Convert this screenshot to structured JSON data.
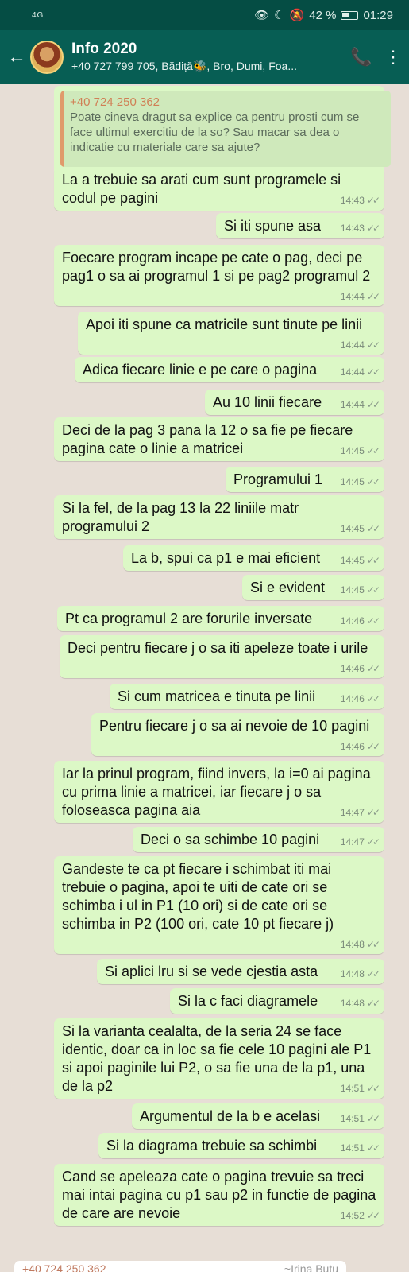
{
  "status": {
    "signal": "4G",
    "battery": "42 %",
    "time": "01:29"
  },
  "header": {
    "back_icon": "arrow-left",
    "title": "Info 2020",
    "subtitle": "+40 727 799 705, Bădiță🐝, Bro, Dumi, Foa...",
    "call_icon": "add-call",
    "menu_icon": "more-vertical"
  },
  "quote": {
    "author": "+40 724 250 362",
    "text": "Poate cineva dragut sa explice ca pentru prosti cum se face ultimul exercitiu de la so? Sau macar sa dea o indicatie cu materiale care sa ajute?"
  },
  "messages": [
    {
      "text": "La a trebuie sa arati cum sunt programele si codul pe pagini",
      "time": "14:43"
    },
    {
      "text": "Si iti spune asa",
      "time": "14:43"
    },
    {
      "text": "Foecare program incape pe cate o pag, deci pe pag1 o sa ai programul 1 si pe pag2 programul 2",
      "time": "14:44"
    },
    {
      "text": "Apoi iti spune ca matricile sunt tinute pe linii",
      "time": "14:44"
    },
    {
      "text": "Adica fiecare linie e pe care o pagina",
      "time": "14:44"
    },
    {
      "text": "Au 10 linii fiecare",
      "time": "14:44"
    },
    {
      "text": "Deci de la pag 3 pana la 12 o sa fie pe fiecare pagina cate o linie a matricei",
      "time": "14:45"
    },
    {
      "text": "Programului 1",
      "time": "14:45"
    },
    {
      "text": "Si la fel, de la pag 13 la 22 liniile matr programului 2",
      "time": "14:45"
    },
    {
      "text": "La b, spui ca p1 e mai eficient",
      "time": "14:45"
    },
    {
      "text": "Si e evident",
      "time": "14:45"
    },
    {
      "text": "Pt ca programul 2 are forurile inversate",
      "time": "14:46"
    },
    {
      "text": "Deci pentru fiecare j o sa iti apeleze toate i urile",
      "time": "14:46"
    },
    {
      "text": "Si cum matricea e tinuta pe linii",
      "time": "14:46"
    },
    {
      "text": "Pentru fiecare j o sa ai nevoie de 10 pagini",
      "time": "14:46"
    },
    {
      "text": "Iar la prinul program, fiind invers, la i=0 ai pagina cu prima linie a matricei, iar fiecare j o sa foloseasca pagina aia",
      "time": "14:47"
    },
    {
      "text": "Deci o sa schimbe 10 pagini",
      "time": "14:47"
    },
    {
      "text": "Gandeste te ca pt fiecare i schimbat iti mai trebuie o pagina, apoi te uiti de cate ori se schimba i ul in P1 (10 ori) si de cate ori se schimba in P2 (100 ori, cate 10 pt fiecare j)",
      "time": "14:48"
    },
    {
      "text": "Si aplici lru si se vede cjestia asta",
      "time": "14:48"
    },
    {
      "text": "Si la c faci diagramele",
      "time": "14:48"
    },
    {
      "text": "Si la varianta cealalta, de la seria 24 se face identic, doar ca in loc sa fie cele 10 pagini ale P1 si apoi paginile lui P2, o sa fie una de la p1, una de la p2",
      "time": "14:51"
    },
    {
      "text": "Argumentul de la b e acelasi",
      "time": "14:51"
    },
    {
      "text": "Si la diagrama trebuie sa schimbi",
      "time": "14:51"
    },
    {
      "text": "Cand se apeleaza cate o pagina trevuie sa treci mai intai pagina cu p1 sau p2 in functie de pagina de care are nevoie",
      "time": "14:52"
    }
  ],
  "bottom_peek": {
    "author": "+40 724 250 362",
    "who": "~Irina Butu"
  }
}
